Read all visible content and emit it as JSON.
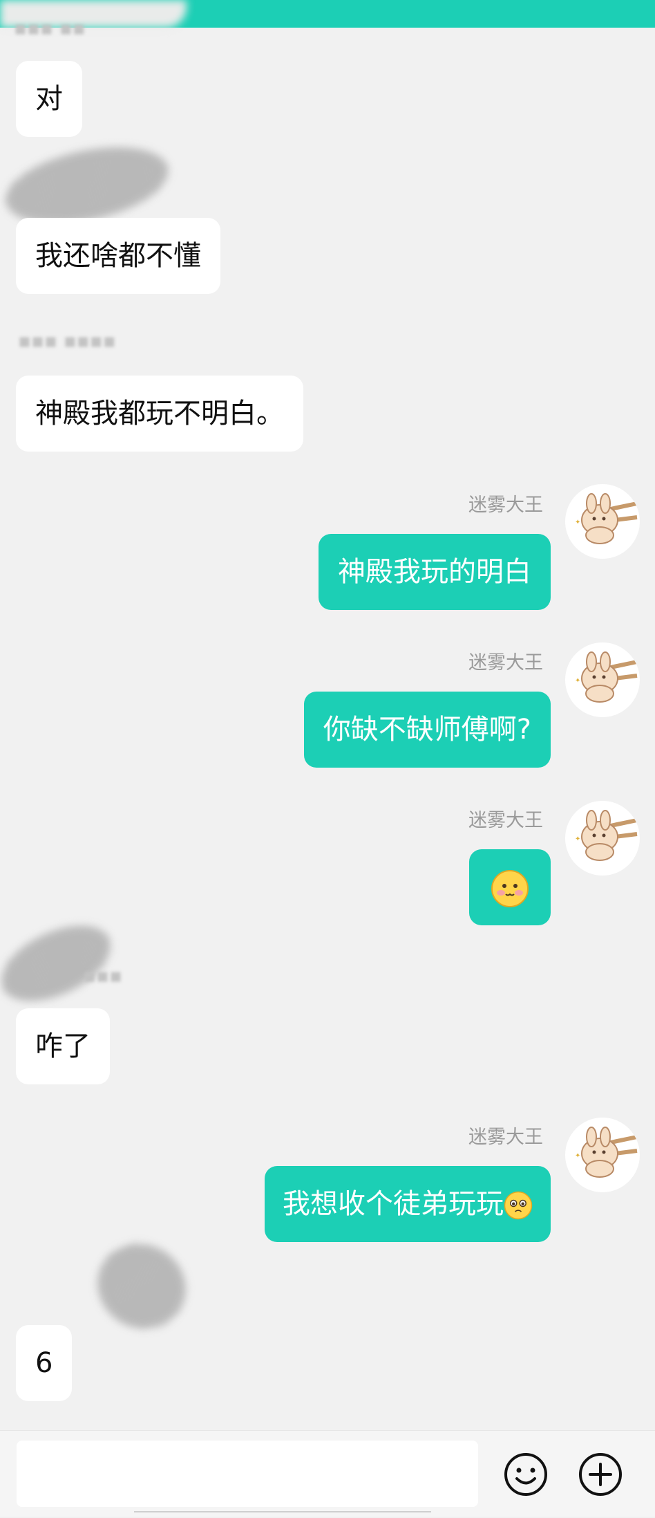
{
  "messages": [
    {
      "text": "对"
    },
    {
      "text": "我还啥都不懂"
    },
    {
      "text": "神殿我都玩不明白。"
    },
    {
      "sender": "迷雾大王",
      "text": "神殿我玩的明白"
    },
    {
      "sender": "迷雾大王",
      "text": "你缺不缺师傅啊?"
    },
    {
      "sender": "迷雾大王",
      "emoji": "blushing-face"
    },
    {
      "text": "咋了"
    },
    {
      "sender": "迷雾大王",
      "text": "我想收个徒弟玩玩",
      "emoji": "pleading-face"
    },
    {
      "text": "6"
    }
  ],
  "input_bar": {
    "placeholder": "",
    "icons": [
      "emoji-icon",
      "add-icon"
    ]
  },
  "colors": {
    "accent": "#1ccfb5",
    "background": "#f1f1f1",
    "incoming_bubble": "#ffffff",
    "sender_text": "#9a9a9a"
  }
}
